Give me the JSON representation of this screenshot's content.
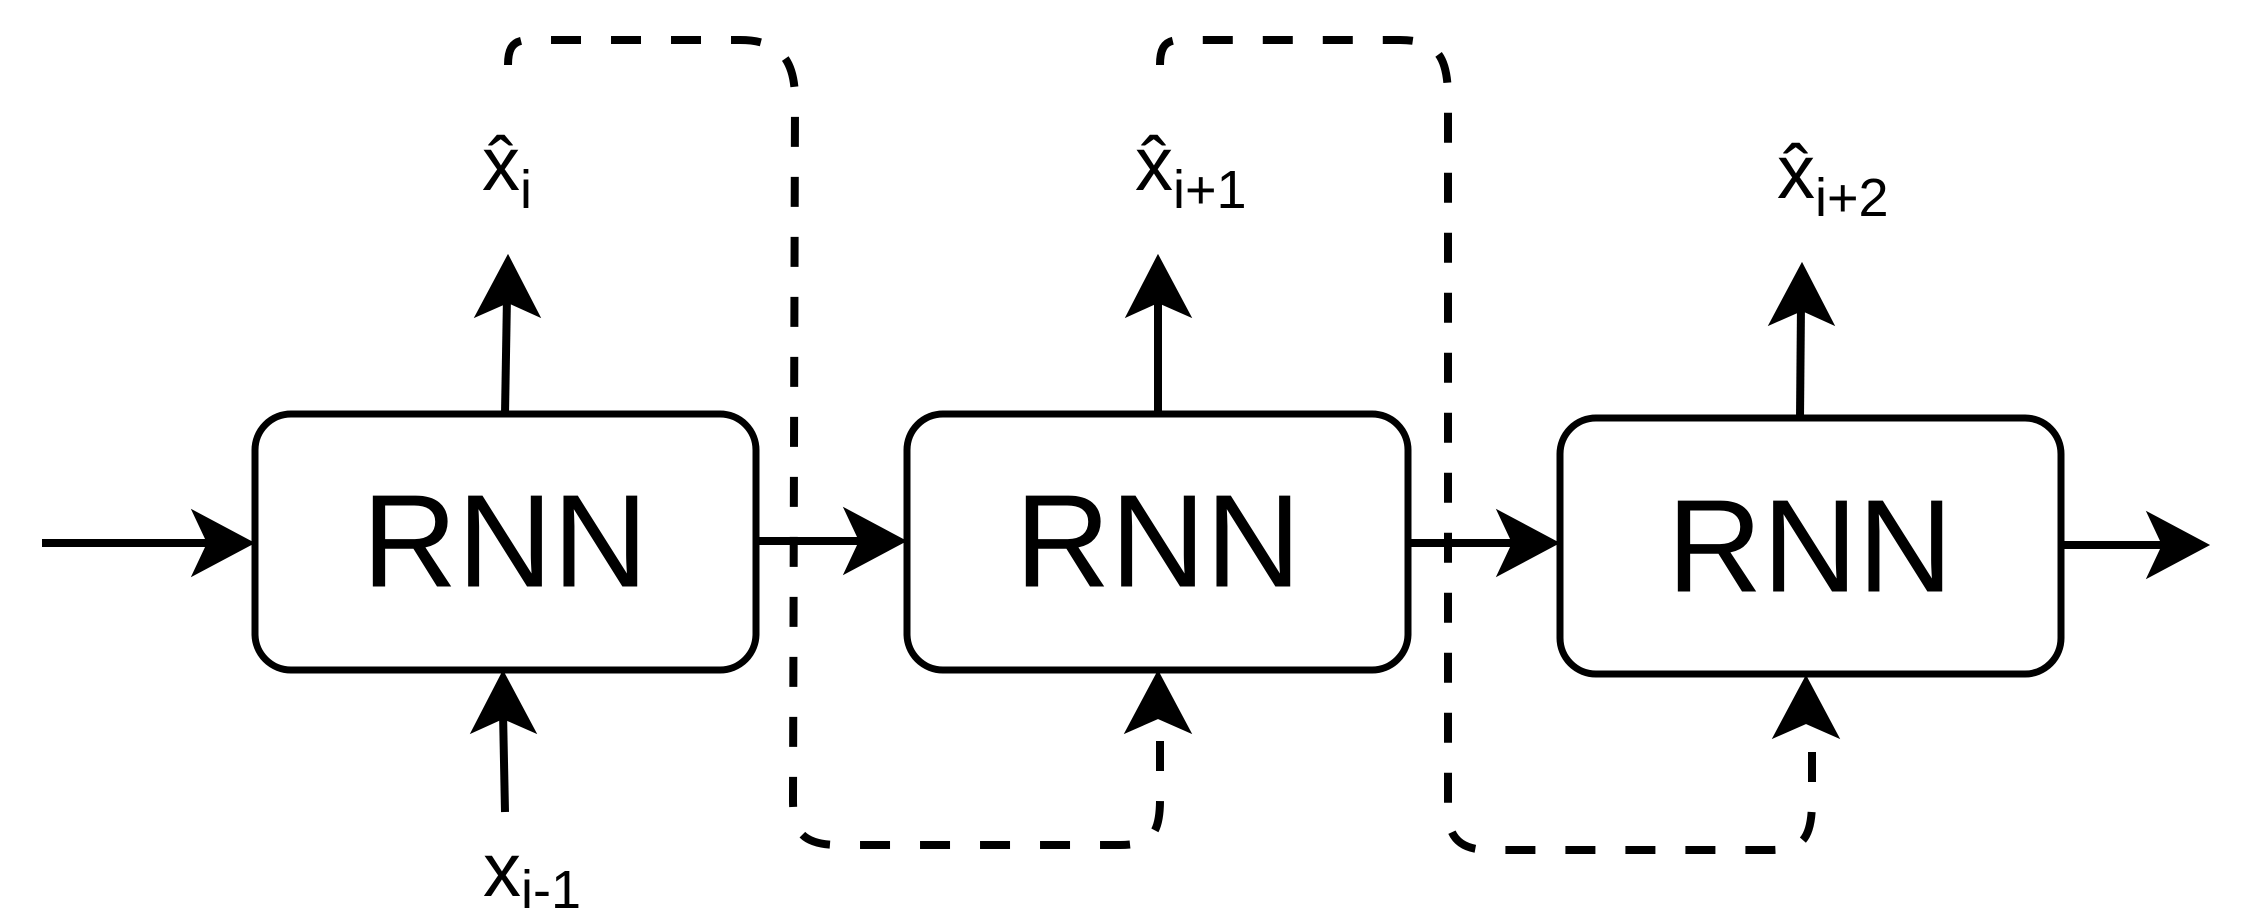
{
  "diagram": {
    "cells": [
      {
        "label": "RNN"
      },
      {
        "label": "RNN"
      },
      {
        "label": "RNN"
      }
    ],
    "outputs": [
      {
        "base": "x̂",
        "sub": "i"
      },
      {
        "base": "x̂",
        "sub": "i+1"
      },
      {
        "base": "x̂",
        "sub": "i+2"
      }
    ],
    "input": {
      "base": "x",
      "sub": "i-1"
    }
  }
}
